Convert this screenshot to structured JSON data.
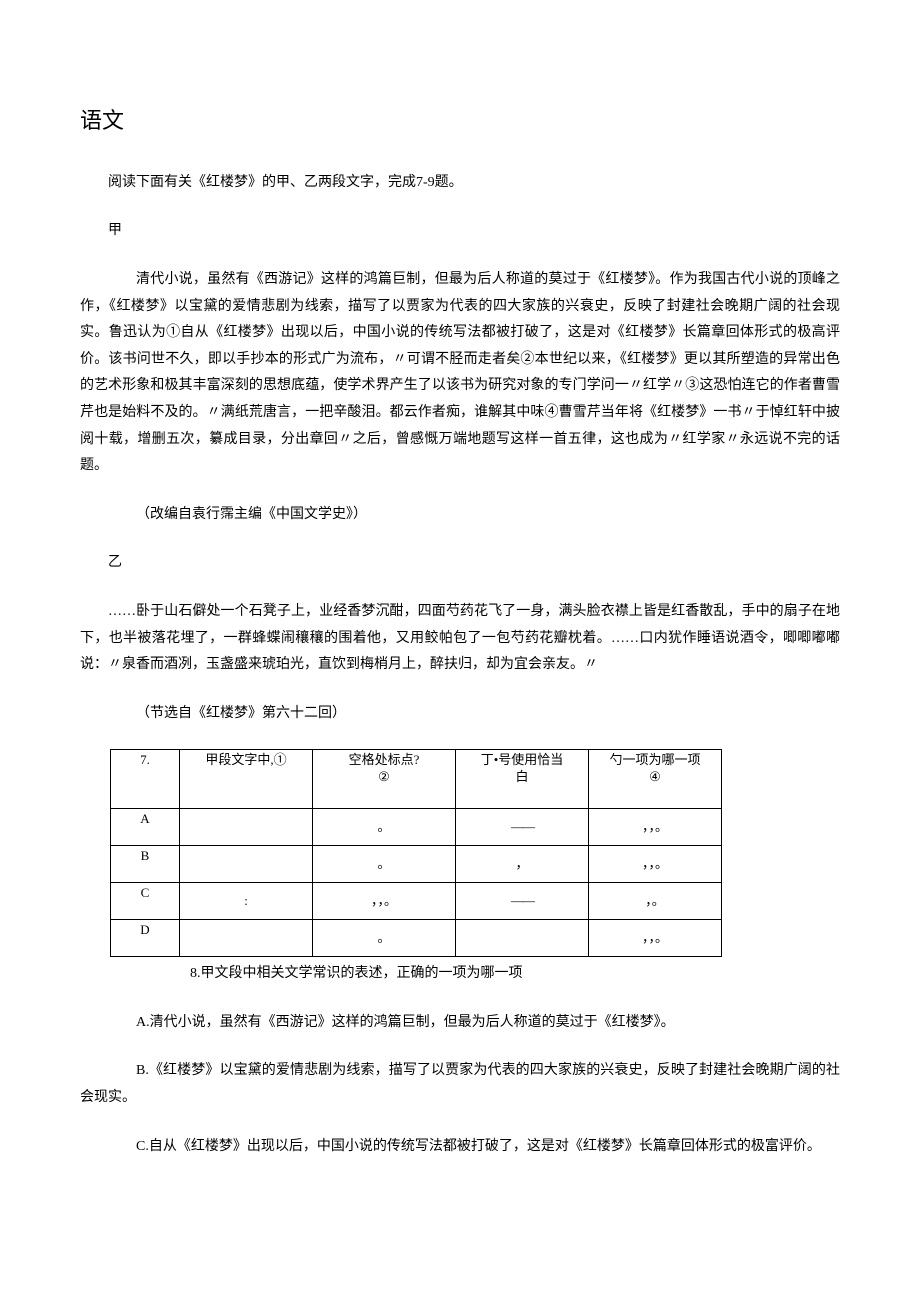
{
  "title": "语文",
  "intro": "阅读下面有关《红楼梦》的甲、乙两段文字，完成7-9题。",
  "labelJia": "甲",
  "paraJia": "清代小说，虽然有《西游记》这样的鸿篇巨制，但最为后人称道的莫过于《红楼梦》。作为我国古代小说的顶峰之作，《红楼梦》以宝黛的爱情悲剧为线索，描写了以贾家为代表的四大家族的兴衰史，反映了封建社会晚期广阔的社会现实。鲁迅认为①自从《红楼梦》出现以后，中国小说的传统写法都被打破了，这是对《红楼梦》长篇章回体形式的极高评价。该书问世不久，即以手抄本的形式广为流布，〃可谓不胫而走者矣②本世纪以来，《红楼梦》更以其所塑造的异常出色的艺术形象和极其丰富深刻的思想底蕴，使学术界产生了以该书为研究对象的专门学问一〃红学〃③这恐怕连它的作者曹雪芹也是始料不及的。〃满纸荒唐言，一把辛酸泪。都云作者痴，谁解其中味④曹雪芹当年将《红楼梦》一书〃于悼红轩中披阅十载，增删五次，纂成目录，分出章回〃之后，曾感慨万端地题写这样一首五律，这也成为〃红学家〃永远说不完的话题。",
  "citeJia": "（改编自袁行霈主编《中国文学史》）",
  "labelYi": "乙",
  "paraYi": "……卧于山石僻处一个石凳子上，业经香梦沉酣，四面芍药花飞了一身，满头脸衣襟上皆是红香散乱，手中的扇子在地下，也半被落花埋了，一群蜂蝶闹穰穰的围着他，又用鲛帕包了一包芍药花瓣枕着。……口内犹作睡语说酒令，唧唧嘟嘟说：〃泉香而酒冽，玉盏盛来琥珀光，直饮到梅梢月上，醉扶归，却为宜会亲友。〃",
  "citeYi": "（节选自《红楼梦》第六十二回）",
  "table": {
    "head": {
      "q": "7.",
      "c1top": "",
      "c1bot": "甲段文字中,①",
      "c2top": "空格处标点?",
      "c2bot": "②",
      "c3top": "丁•号使用恰当",
      "c3bot": "白",
      "c4top": "勺一项为哪一项",
      "c4bot": "④"
    },
    "rows": [
      {
        "opt": "A",
        "c1": "",
        "c2": "。",
        "c3": "——",
        "c4": "，，。"
      },
      {
        "opt": "B",
        "c1": "",
        "c2": "。",
        "c3": "，",
        "c4": "，，。"
      },
      {
        "opt": "C",
        "c1": ":",
        "c2": "，，。",
        "c3": "——",
        "c4": "，。"
      },
      {
        "opt": "D",
        "c1": "",
        "c2": "。",
        "c3": "",
        "c4": "，，。"
      }
    ]
  },
  "q8": "8.甲文段中相关文学常识的表述，正确的一项为哪一项",
  "q8A": "A.清代小说，虽然有《西游记》这样的鸿篇巨制，但最为后人称道的莫过于《红楼梦》。",
  "q8B": "B.《红楼梦》以宝黛的爱情悲剧为线索，描写了以贾家为代表的四大家族的兴衰史，反映了封建社会晚期广阔的社会现实。",
  "q8C": "C.自从《红楼梦》出现以后，中国小说的传统写法都被打破了，这是对《红楼梦》长篇章回体形式的极富评价。"
}
